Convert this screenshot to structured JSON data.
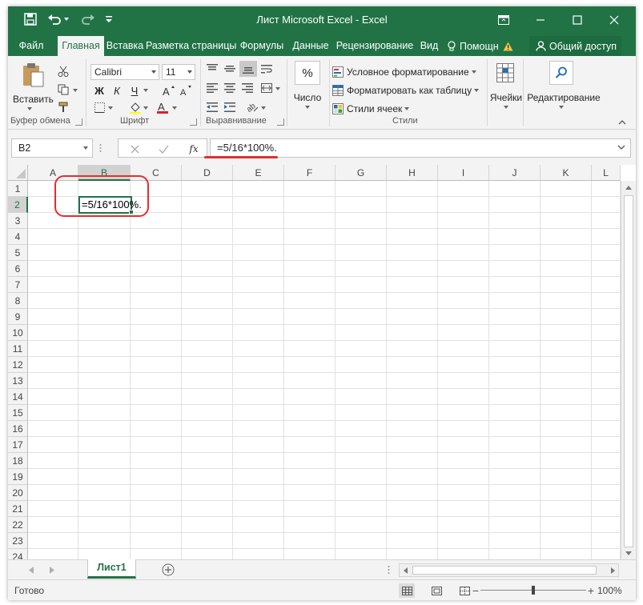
{
  "window": {
    "title": "Лист Microsoft Excel - Excel"
  },
  "tabs": [
    {
      "label": "Файл",
      "active": false
    },
    {
      "label": "Главная",
      "active": true
    },
    {
      "label": "Вставка",
      "active": false
    },
    {
      "label": "Разметка страницы",
      "active": false
    },
    {
      "label": "Формулы",
      "active": false
    },
    {
      "label": "Данные",
      "active": false
    },
    {
      "label": "Рецензирование",
      "active": false
    },
    {
      "label": "Вид",
      "active": false
    }
  ],
  "tell_me": "Помощн",
  "share_label": "Общий доступ",
  "ribbon": {
    "clipboard": {
      "paste_label": "Вставить",
      "group_label": "Буфер обмена"
    },
    "font": {
      "font_name": "Calibri",
      "font_size": "11",
      "bold": "Ж",
      "italic": "К",
      "underline": "Ч",
      "group_label": "Шрифт"
    },
    "alignment": {
      "group_label": "Выравнивание"
    },
    "number": {
      "label": "Число",
      "symbol": "%"
    },
    "styles": {
      "conditional": "Условное форматирование",
      "format_table": "Форматировать как таблицу",
      "cell_styles": "Стили ячеек",
      "group_label": "Стили"
    },
    "cells": {
      "label": "Ячейки"
    },
    "editing": {
      "label": "Редактирование"
    }
  },
  "formula_bar": {
    "name_box": "B2",
    "formula": "=5/16*100%."
  },
  "grid": {
    "columns": [
      "A",
      "B",
      "C",
      "D",
      "E",
      "F",
      "G",
      "H",
      "I",
      "J",
      "K",
      "L"
    ],
    "rows": [
      "1",
      "2",
      "3",
      "4",
      "5",
      "6",
      "7",
      "8",
      "9",
      "10",
      "11",
      "12",
      "13",
      "14",
      "15",
      "16",
      "17",
      "18",
      "19",
      "20",
      "21",
      "22",
      "23",
      "24"
    ],
    "selected_column": "B",
    "selected_row": "2",
    "active_cell_text": "=5/16*100%."
  },
  "sheets": [
    {
      "label": "Лист1",
      "active": true
    }
  ],
  "status": {
    "text": "Готово",
    "zoom": "100%"
  },
  "colors": {
    "excel_green": "#217346",
    "annotation_red": "#e03030"
  }
}
